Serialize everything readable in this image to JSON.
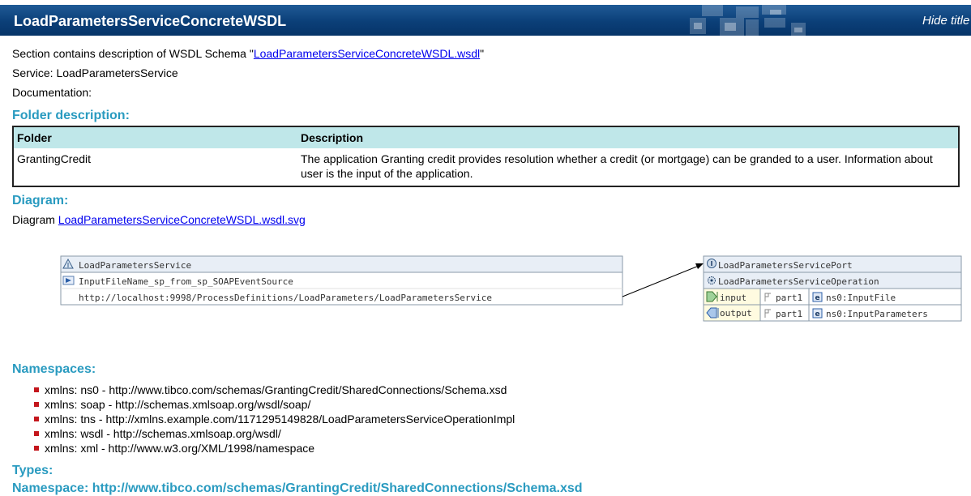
{
  "header": {
    "title": "LoadParametersServiceConcreteWSDL",
    "hide_link": "Hide title"
  },
  "intro": {
    "section_prefix": "Section contains description of WSDL Schema \"",
    "section_link": "LoadParametersServiceConcreteWSDL.wsdl",
    "section_suffix": "\"",
    "service_line": "Service: LoadParametersService",
    "documentation_line": "Documentation:"
  },
  "folder_section": {
    "heading": "Folder description:",
    "columns": [
      "Folder",
      "Description"
    ],
    "rows": [
      {
        "folder": "GrantingCredit",
        "description": "The application Granting credit provides resolution whether a credit (or mortgage) can be granded to a user. Information about user is the input of the application."
      }
    ]
  },
  "diagram_section": {
    "heading": "Diagram:",
    "prefix": "Diagram ",
    "link": "LoadParametersServiceConcreteWSDL.wsdl.svg"
  },
  "diagram": {
    "service": {
      "name": "LoadParametersService",
      "port": "InputFileName_sp_from_sp_SOAPEventSource",
      "address": "http://localhost:9998/ProcessDefinitions/LoadParameters/LoadParametersService"
    },
    "porttype": {
      "name": "LoadParametersServicePort",
      "operation": "LoadParametersServiceOperation",
      "messages": [
        {
          "dir": "input",
          "part": "part1",
          "element": "ns0:InputFile"
        },
        {
          "dir": "output",
          "part": "part1",
          "element": "ns0:InputParameters"
        }
      ]
    },
    "colors": {
      "box_header": "#e8eef6",
      "msg_dir_bg": "#fffbe0",
      "border": "#8a9aa8"
    }
  },
  "namespaces_section": {
    "heading": "Namespaces:",
    "items": [
      "xmlns: ns0 - http://www.tibco.com/schemas/GrantingCredit/SharedConnections/Schema.xsd",
      "xmlns: soap - http://schemas.xmlsoap.org/wsdl/soap/",
      "xmlns: tns - http://xmlns.example.com/1171295149828/LoadParametersServiceOperationImpl",
      "xmlns: wsdl - http://schemas.xmlsoap.org/wsdl/",
      "xmlns: xml - http://www.w3.org/XML/1998/namespace"
    ]
  },
  "types_section": {
    "heading": "Types:",
    "namespace_line": "Namespace: http://www.tibco.com/schemas/GrantingCredit/SharedConnections/Schema.xsd"
  },
  "theme": {
    "accent": "#2a9bc0",
    "title_bg": "#0b3f78",
    "bullet": "#c4161c",
    "table_header": "#bfe7e9"
  }
}
